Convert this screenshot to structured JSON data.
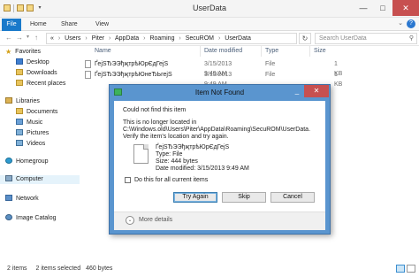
{
  "window": {
    "title": "UserData",
    "minimize": "—",
    "maximize": "□",
    "close": "✕"
  },
  "ribbon": {
    "tabs": [
      "File",
      "Home",
      "Share",
      "View"
    ],
    "help": "?",
    "collapse": "⌄"
  },
  "address": {
    "back": "←",
    "forward": "→",
    "up": "↑",
    "segments": [
      "«",
      "Users",
      "Piter",
      "AppData",
      "Roaming",
      "SecuROM",
      "UserData"
    ],
    "separator": "›",
    "refresh": "↻",
    "search_placeholder": "Search UserData",
    "search_icon": "search-icon"
  },
  "nav": {
    "favorites": "Favorites",
    "desktop": "Desktop",
    "downloads": "Downloads",
    "recent": "Recent places",
    "libraries": "Libraries",
    "documents": "Documents",
    "music": "Music",
    "pictures": "Pictures",
    "videos": "Videos",
    "homegroup": "Homegroup",
    "computer": "Computer",
    "network": "Network",
    "imagecatalog": "Image Catalog"
  },
  "columns": {
    "name": "Name",
    "date": "Date modified",
    "type": "Type",
    "size": "Size"
  },
  "files": [
    {
      "name": "ҐејЅЂЭЭђҗтрѣЮрЄдГејЅ",
      "date": "3/15/2013 9:49 AM",
      "type": "File",
      "size": "1 KB"
    },
    {
      "name": "ҐејЅЂЭЭђҗтрѣЮнеЂЬгејЅ",
      "date": "3/15/2013 9:49 AM",
      "type": "File",
      "size": "1 KB"
    }
  ],
  "status": {
    "count": "2 items",
    "selected": "2 items selected",
    "bytes": "460 bytes"
  },
  "dialog": {
    "title": "Item Not Found",
    "heading": "Could not find this item",
    "message_1": "This is no longer located in",
    "message_2": "C:\\Windows.old\\Users\\Piter\\AppData\\Roaming\\SecuROM\\UserData.",
    "message_3": "Verify the item's location and try again.",
    "file_name": "ҐејЅЂЭЭђҗтрѣЮрЄдГејЅ",
    "file_type": "Type: File",
    "file_size": "Size: 444 bytes",
    "file_date": "Date modified: 3/15/2013 9:49 AM",
    "checkbox_label": "Do this for all current items",
    "try_again": "Try Again",
    "skip": "Skip",
    "cancel": "Cancel",
    "more_details": "More details",
    "more_icon": "⌄"
  }
}
